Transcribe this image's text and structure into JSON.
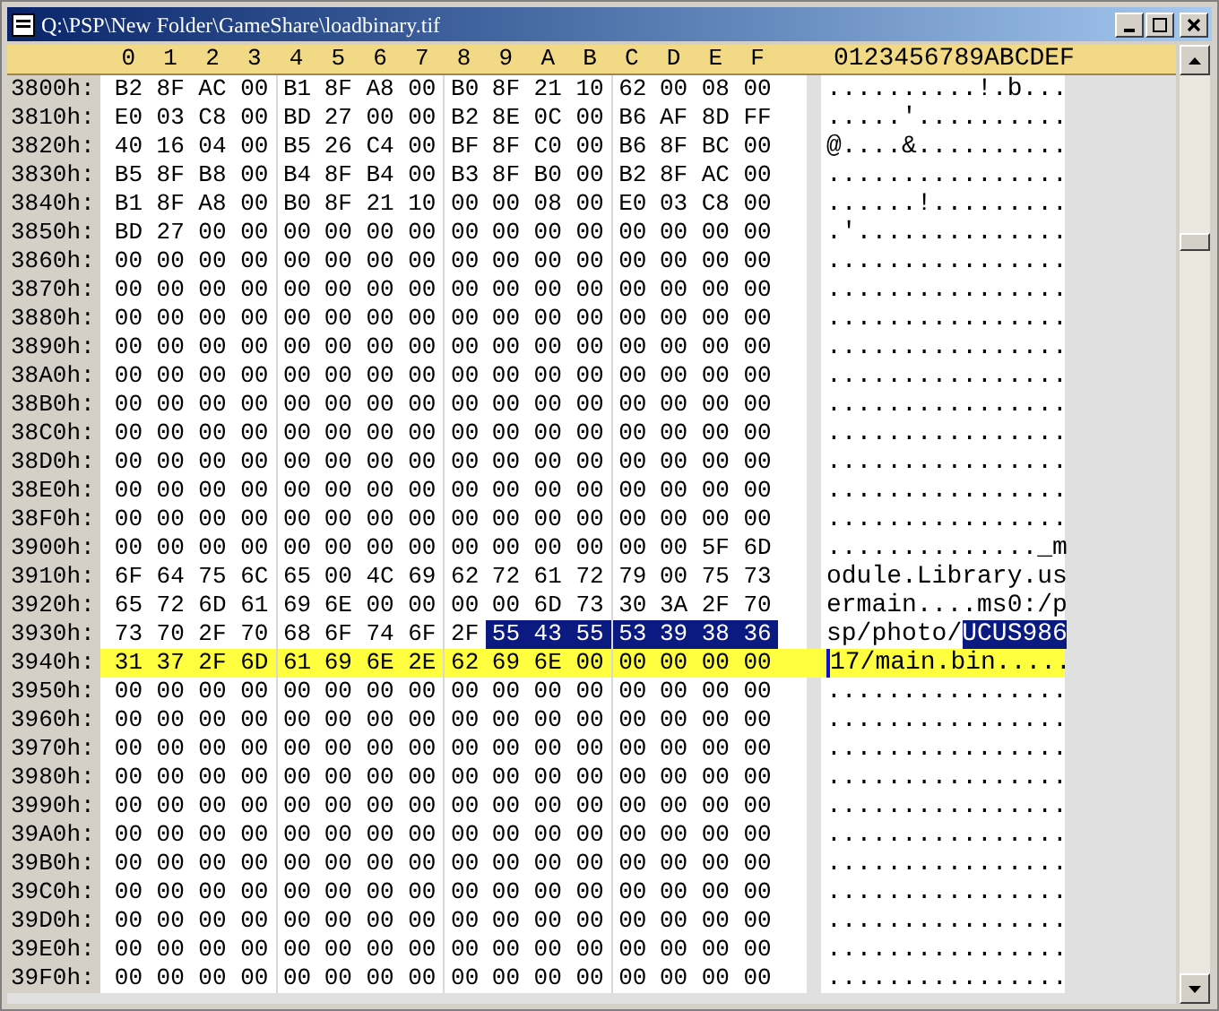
{
  "window": {
    "title": "Q:\\PSP\\New Folder\\GameShare\\loadbinary.tif"
  },
  "header": {
    "columns": [
      "0",
      "1",
      "2",
      "3",
      "4",
      "5",
      "6",
      "7",
      "8",
      "9",
      "A",
      "B",
      "C",
      "D",
      "E",
      "F"
    ],
    "ascii_label": "0123456789ABCDEF"
  },
  "rows": [
    {
      "offset": "3800h:",
      "current": false,
      "hex": [
        {
          "kind": "plain",
          "bytes": [
            "B2",
            "8F",
            "AC",
            "00",
            "B1",
            "8F",
            "A8",
            "00",
            "B0",
            "8F",
            "21",
            "10",
            "62",
            "00",
            "08",
            "00"
          ]
        }
      ],
      "ascii": [
        {
          "kind": "plain",
          "text": "..........!.b..."
        }
      ]
    },
    {
      "offset": "3810h:",
      "current": false,
      "hex": [
        {
          "kind": "plain",
          "bytes": [
            "E0",
            "03",
            "C8",
            "00",
            "BD",
            "27",
            "00",
            "00",
            "B2",
            "8E",
            "0C",
            "00",
            "B6",
            "AF",
            "8D",
            "FF"
          ]
        }
      ],
      "ascii": [
        {
          "kind": "plain",
          "text": ".....'.........."
        }
      ]
    },
    {
      "offset": "3820h:",
      "current": false,
      "hex": [
        {
          "kind": "plain",
          "bytes": [
            "40",
            "16",
            "04",
            "00",
            "B5",
            "26",
            "C4",
            "00",
            "BF",
            "8F",
            "C0",
            "00",
            "B6",
            "8F",
            "BC",
            "00"
          ]
        }
      ],
      "ascii": [
        {
          "kind": "plain",
          "text": "@....&.........."
        }
      ]
    },
    {
      "offset": "3830h:",
      "current": false,
      "hex": [
        {
          "kind": "plain",
          "bytes": [
            "B5",
            "8F",
            "B8",
            "00",
            "B4",
            "8F",
            "B4",
            "00",
            "B3",
            "8F",
            "B0",
            "00",
            "B2",
            "8F",
            "AC",
            "00"
          ]
        }
      ],
      "ascii": [
        {
          "kind": "plain",
          "text": "................"
        }
      ]
    },
    {
      "offset": "3840h:",
      "current": false,
      "hex": [
        {
          "kind": "plain",
          "bytes": [
            "B1",
            "8F",
            "A8",
            "00",
            "B0",
            "8F",
            "21",
            "10",
            "00",
            "00",
            "08",
            "00",
            "E0",
            "03",
            "C8",
            "00"
          ]
        }
      ],
      "ascii": [
        {
          "kind": "plain",
          "text": "......!........."
        }
      ]
    },
    {
      "offset": "3850h:",
      "current": false,
      "hex": [
        {
          "kind": "plain",
          "bytes": [
            "BD",
            "27",
            "00",
            "00",
            "00",
            "00",
            "00",
            "00",
            "00",
            "00",
            "00",
            "00",
            "00",
            "00",
            "00",
            "00"
          ]
        }
      ],
      "ascii": [
        {
          "kind": "plain",
          "text": ".'.............."
        }
      ]
    },
    {
      "offset": "3860h:",
      "current": false,
      "hex": [
        {
          "kind": "plain",
          "bytes": [
            "00",
            "00",
            "00",
            "00",
            "00",
            "00",
            "00",
            "00",
            "00",
            "00",
            "00",
            "00",
            "00",
            "00",
            "00",
            "00"
          ]
        }
      ],
      "ascii": [
        {
          "kind": "plain",
          "text": "................"
        }
      ]
    },
    {
      "offset": "3870h:",
      "current": false,
      "hex": [
        {
          "kind": "plain",
          "bytes": [
            "00",
            "00",
            "00",
            "00",
            "00",
            "00",
            "00",
            "00",
            "00",
            "00",
            "00",
            "00",
            "00",
            "00",
            "00",
            "00"
          ]
        }
      ],
      "ascii": [
        {
          "kind": "plain",
          "text": "................"
        }
      ]
    },
    {
      "offset": "3880h:",
      "current": false,
      "hex": [
        {
          "kind": "plain",
          "bytes": [
            "00",
            "00",
            "00",
            "00",
            "00",
            "00",
            "00",
            "00",
            "00",
            "00",
            "00",
            "00",
            "00",
            "00",
            "00",
            "00"
          ]
        }
      ],
      "ascii": [
        {
          "kind": "plain",
          "text": "................"
        }
      ]
    },
    {
      "offset": "3890h:",
      "current": false,
      "hex": [
        {
          "kind": "plain",
          "bytes": [
            "00",
            "00",
            "00",
            "00",
            "00",
            "00",
            "00",
            "00",
            "00",
            "00",
            "00",
            "00",
            "00",
            "00",
            "00",
            "00"
          ]
        }
      ],
      "ascii": [
        {
          "kind": "plain",
          "text": "................"
        }
      ]
    },
    {
      "offset": "38A0h:",
      "current": false,
      "hex": [
        {
          "kind": "plain",
          "bytes": [
            "00",
            "00",
            "00",
            "00",
            "00",
            "00",
            "00",
            "00",
            "00",
            "00",
            "00",
            "00",
            "00",
            "00",
            "00",
            "00"
          ]
        }
      ],
      "ascii": [
        {
          "kind": "plain",
          "text": "................"
        }
      ]
    },
    {
      "offset": "38B0h:",
      "current": false,
      "hex": [
        {
          "kind": "plain",
          "bytes": [
            "00",
            "00",
            "00",
            "00",
            "00",
            "00",
            "00",
            "00",
            "00",
            "00",
            "00",
            "00",
            "00",
            "00",
            "00",
            "00"
          ]
        }
      ],
      "ascii": [
        {
          "kind": "plain",
          "text": "................"
        }
      ]
    },
    {
      "offset": "38C0h:",
      "current": false,
      "hex": [
        {
          "kind": "plain",
          "bytes": [
            "00",
            "00",
            "00",
            "00",
            "00",
            "00",
            "00",
            "00",
            "00",
            "00",
            "00",
            "00",
            "00",
            "00",
            "00",
            "00"
          ]
        }
      ],
      "ascii": [
        {
          "kind": "plain",
          "text": "................"
        }
      ]
    },
    {
      "offset": "38D0h:",
      "current": false,
      "hex": [
        {
          "kind": "plain",
          "bytes": [
            "00",
            "00",
            "00",
            "00",
            "00",
            "00",
            "00",
            "00",
            "00",
            "00",
            "00",
            "00",
            "00",
            "00",
            "00",
            "00"
          ]
        }
      ],
      "ascii": [
        {
          "kind": "plain",
          "text": "................"
        }
      ]
    },
    {
      "offset": "38E0h:",
      "current": false,
      "hex": [
        {
          "kind": "plain",
          "bytes": [
            "00",
            "00",
            "00",
            "00",
            "00",
            "00",
            "00",
            "00",
            "00",
            "00",
            "00",
            "00",
            "00",
            "00",
            "00",
            "00"
          ]
        }
      ],
      "ascii": [
        {
          "kind": "plain",
          "text": "................"
        }
      ]
    },
    {
      "offset": "38F0h:",
      "current": false,
      "hex": [
        {
          "kind": "plain",
          "bytes": [
            "00",
            "00",
            "00",
            "00",
            "00",
            "00",
            "00",
            "00",
            "00",
            "00",
            "00",
            "00",
            "00",
            "00",
            "00",
            "00"
          ]
        }
      ],
      "ascii": [
        {
          "kind": "plain",
          "text": "................"
        }
      ]
    },
    {
      "offset": "3900h:",
      "current": false,
      "hex": [
        {
          "kind": "plain",
          "bytes": [
            "00",
            "00",
            "00",
            "00",
            "00",
            "00",
            "00",
            "00",
            "00",
            "00",
            "00",
            "00",
            "00",
            "00",
            "5F",
            "6D"
          ]
        }
      ],
      "ascii": [
        {
          "kind": "plain",
          "text": ".............._m"
        }
      ]
    },
    {
      "offset": "3910h:",
      "current": false,
      "hex": [
        {
          "kind": "plain",
          "bytes": [
            "6F",
            "64",
            "75",
            "6C",
            "65",
            "00",
            "4C",
            "69",
            "62",
            "72",
            "61",
            "72",
            "79",
            "00",
            "75",
            "73"
          ]
        }
      ],
      "ascii": [
        {
          "kind": "plain",
          "text": "odule.Library.us"
        }
      ]
    },
    {
      "offset": "3920h:",
      "current": false,
      "hex": [
        {
          "kind": "plain",
          "bytes": [
            "65",
            "72",
            "6D",
            "61",
            "69",
            "6E",
            "00",
            "00",
            "00",
            "00",
            "6D",
            "73",
            "30",
            "3A",
            "2F",
            "70"
          ]
        }
      ],
      "ascii": [
        {
          "kind": "plain",
          "text": "ermain....ms0:/p"
        }
      ]
    },
    {
      "offset": "3930h:",
      "current": false,
      "hex": [
        {
          "kind": "plain",
          "bytes": [
            "73",
            "70",
            "2F",
            "70",
            "68",
            "6F",
            "74",
            "6F",
            "2F"
          ]
        },
        {
          "kind": "selected",
          "bytes": [
            "55",
            "43",
            "55",
            "53",
            "39",
            "38",
            "36"
          ]
        }
      ],
      "ascii": [
        {
          "kind": "plain",
          "text": "sp/photo/"
        },
        {
          "kind": "selected",
          "text": "UCUS986"
        }
      ]
    },
    {
      "offset": "3940h:",
      "current": true,
      "hex": [
        {
          "kind": "plain",
          "bytes": [
            "31",
            "37",
            "2F",
            "6D",
            "61",
            "69",
            "6E",
            "2E",
            "62",
            "69",
            "6E",
            "00",
            "00",
            "00",
            "00",
            "00"
          ]
        }
      ],
      "ascii": [
        {
          "kind": "cursor",
          "text": "1"
        },
        {
          "kind": "plain",
          "text": "7/main.bin....."
        }
      ]
    },
    {
      "offset": "3950h:",
      "current": false,
      "hex": [
        {
          "kind": "plain",
          "bytes": [
            "00",
            "00",
            "00",
            "00",
            "00",
            "00",
            "00",
            "00",
            "00",
            "00",
            "00",
            "00",
            "00",
            "00",
            "00",
            "00"
          ]
        }
      ],
      "ascii": [
        {
          "kind": "plain",
          "text": "................"
        }
      ]
    },
    {
      "offset": "3960h:",
      "current": false,
      "hex": [
        {
          "kind": "plain",
          "bytes": [
            "00",
            "00",
            "00",
            "00",
            "00",
            "00",
            "00",
            "00",
            "00",
            "00",
            "00",
            "00",
            "00",
            "00",
            "00",
            "00"
          ]
        }
      ],
      "ascii": [
        {
          "kind": "plain",
          "text": "................"
        }
      ]
    },
    {
      "offset": "3970h:",
      "current": false,
      "hex": [
        {
          "kind": "plain",
          "bytes": [
            "00",
            "00",
            "00",
            "00",
            "00",
            "00",
            "00",
            "00",
            "00",
            "00",
            "00",
            "00",
            "00",
            "00",
            "00",
            "00"
          ]
        }
      ],
      "ascii": [
        {
          "kind": "plain",
          "text": "................"
        }
      ]
    },
    {
      "offset": "3980h:",
      "current": false,
      "hex": [
        {
          "kind": "plain",
          "bytes": [
            "00",
            "00",
            "00",
            "00",
            "00",
            "00",
            "00",
            "00",
            "00",
            "00",
            "00",
            "00",
            "00",
            "00",
            "00",
            "00"
          ]
        }
      ],
      "ascii": [
        {
          "kind": "plain",
          "text": "................"
        }
      ]
    },
    {
      "offset": "3990h:",
      "current": false,
      "hex": [
        {
          "kind": "plain",
          "bytes": [
            "00",
            "00",
            "00",
            "00",
            "00",
            "00",
            "00",
            "00",
            "00",
            "00",
            "00",
            "00",
            "00",
            "00",
            "00",
            "00"
          ]
        }
      ],
      "ascii": [
        {
          "kind": "plain",
          "text": "................"
        }
      ]
    },
    {
      "offset": "39A0h:",
      "current": false,
      "hex": [
        {
          "kind": "plain",
          "bytes": [
            "00",
            "00",
            "00",
            "00",
            "00",
            "00",
            "00",
            "00",
            "00",
            "00",
            "00",
            "00",
            "00",
            "00",
            "00",
            "00"
          ]
        }
      ],
      "ascii": [
        {
          "kind": "plain",
          "text": "................"
        }
      ]
    },
    {
      "offset": "39B0h:",
      "current": false,
      "hex": [
        {
          "kind": "plain",
          "bytes": [
            "00",
            "00",
            "00",
            "00",
            "00",
            "00",
            "00",
            "00",
            "00",
            "00",
            "00",
            "00",
            "00",
            "00",
            "00",
            "00"
          ]
        }
      ],
      "ascii": [
        {
          "kind": "plain",
          "text": "................"
        }
      ]
    },
    {
      "offset": "39C0h:",
      "current": false,
      "hex": [
        {
          "kind": "plain",
          "bytes": [
            "00",
            "00",
            "00",
            "00",
            "00",
            "00",
            "00",
            "00",
            "00",
            "00",
            "00",
            "00",
            "00",
            "00",
            "00",
            "00"
          ]
        }
      ],
      "ascii": [
        {
          "kind": "plain",
          "text": "................"
        }
      ]
    },
    {
      "offset": "39D0h:",
      "current": false,
      "hex": [
        {
          "kind": "plain",
          "bytes": [
            "00",
            "00",
            "00",
            "00",
            "00",
            "00",
            "00",
            "00",
            "00",
            "00",
            "00",
            "00",
            "00",
            "00",
            "00",
            "00"
          ]
        }
      ],
      "ascii": [
        {
          "kind": "plain",
          "text": "................"
        }
      ]
    },
    {
      "offset": "39E0h:",
      "current": false,
      "hex": [
        {
          "kind": "plain",
          "bytes": [
            "00",
            "00",
            "00",
            "00",
            "00",
            "00",
            "00",
            "00",
            "00",
            "00",
            "00",
            "00",
            "00",
            "00",
            "00",
            "00"
          ]
        }
      ],
      "ascii": [
        {
          "kind": "plain",
          "text": "................"
        }
      ]
    },
    {
      "offset": "39F0h:",
      "current": false,
      "hex": [
        {
          "kind": "plain",
          "bytes": [
            "00",
            "00",
            "00",
            "00",
            "00",
            "00",
            "00",
            "00",
            "00",
            "00",
            "00",
            "00",
            "00",
            "00",
            "00",
            "00"
          ]
        }
      ],
      "ascii": [
        {
          "kind": "plain",
          "text": "................"
        }
      ]
    }
  ]
}
